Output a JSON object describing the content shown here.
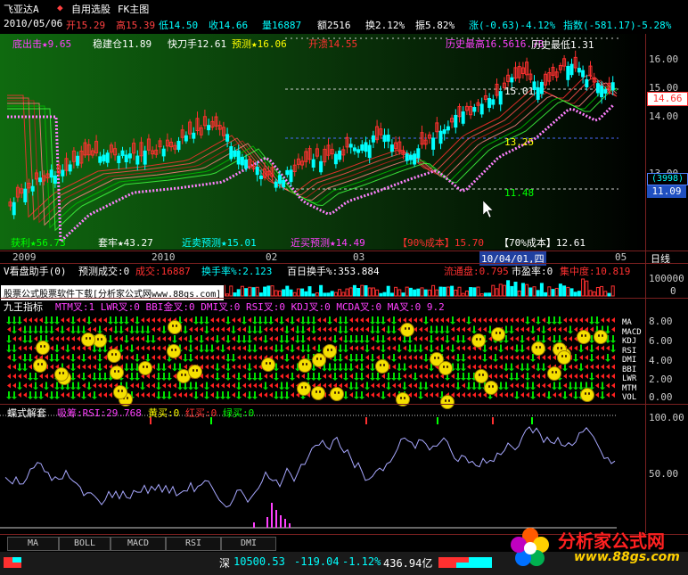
{
  "window": {
    "title": "飞亚达A",
    "tab_active": "自用选股",
    "tab_other": "FK主图"
  },
  "quote": {
    "date": "2010/05/06",
    "open": "开15.29",
    "high": "高15.39",
    "low": "低14.50",
    "close": "收14.66",
    "volume": "量16887",
    "amount": "额2516",
    "turnover": "换2.12%",
    "amplitude": "振5.82%",
    "change": "涨(-0.63)-4.12%",
    "index": "指数(-581.17)-5.28%"
  },
  "main_indicators": {
    "bottom_attack": "底出击★9.65",
    "steady_hold": "稳建仓11.89",
    "fast_knife": "快刀手12.61",
    "forecast": "预测★16.06",
    "resistance": "开溃14.55",
    "hist_high": "历史最高16.5616.78",
    "hist_low": "历史最低1.31",
    "profit": "获利★56.73",
    "trapped": "套牢★43.27",
    "near_sell": "近卖预测★15.01",
    "near_buy": "近买预测★14.49",
    "cost90": "【90%成本】15.70",
    "cost70": "【70%成本】12.61",
    "line_label_1": "15.01",
    "line_label_2": "13.25",
    "line_label_3": "11.48"
  },
  "main_axis": {
    "ticks": [
      "16.00",
      "15.00",
      "14.00",
      "13.00",
      "11.09"
    ],
    "price_box": "14.66",
    "days_box": "(3998)",
    "unit": "日线"
  },
  "time_axis": {
    "labels": [
      "2009",
      "2010",
      "02",
      "03",
      "10/04/01,四",
      "05"
    ]
  },
  "vol_panel": {
    "title": "V看盘助手(0)",
    "forecast": "预测成交:0",
    "volume": "成交:16887",
    "turnover_rate": "换手率%:2.123",
    "hundred_day": "百日换手%:353.884",
    "circ_cap": "流通盘:0.795",
    "pe": "市盈率:0",
    "concentration": "集中度:10.819",
    "ticks": [
      "100000",
      "0"
    ]
  },
  "watermark": "股票公式股票软件下载[分析家公式网www.88gs.com]",
  "indicator9": {
    "title": "九王指标",
    "text": "MTM叉:1 LWR叉:0 BBI金叉:0 DMI叉:0 RSI叉:0 KDJ叉:0 MCDA叉:0 MA叉:0 9.2",
    "rows": [
      "MA",
      "MACD",
      "KDJ",
      "RSI",
      "DMI",
      "BBI",
      "LWR",
      "MTM",
      "VOL"
    ],
    "ticks": [
      "8.00",
      "6.00",
      "4.00",
      "2.00",
      "0.00"
    ]
  },
  "osc_panel": {
    "title": "蝶式解套",
    "rsi": "吸筹:RSI:29.768",
    "yellow": "黄买:0",
    "red": "红买:0",
    "green": "绿买:0",
    "ticks": [
      "100.00",
      "50.00"
    ]
  },
  "tabs": [
    "MA",
    "BOLL",
    "MACD",
    "RSI",
    "DMI"
  ],
  "status": {
    "market": "深",
    "index_val": "10500.53",
    "index_chg": "-119.04",
    "index_pct": "-1.12%",
    "turnover": "436.94亿"
  },
  "brand": {
    "name": "分析家公式网",
    "url": "www.88gs.com"
  },
  "colors": {
    "up": "#ff3030",
    "down": "#00ffff",
    "green_bar": "#00c000",
    "yellow": "#f5e000",
    "magenta": "#ff40ff"
  }
}
